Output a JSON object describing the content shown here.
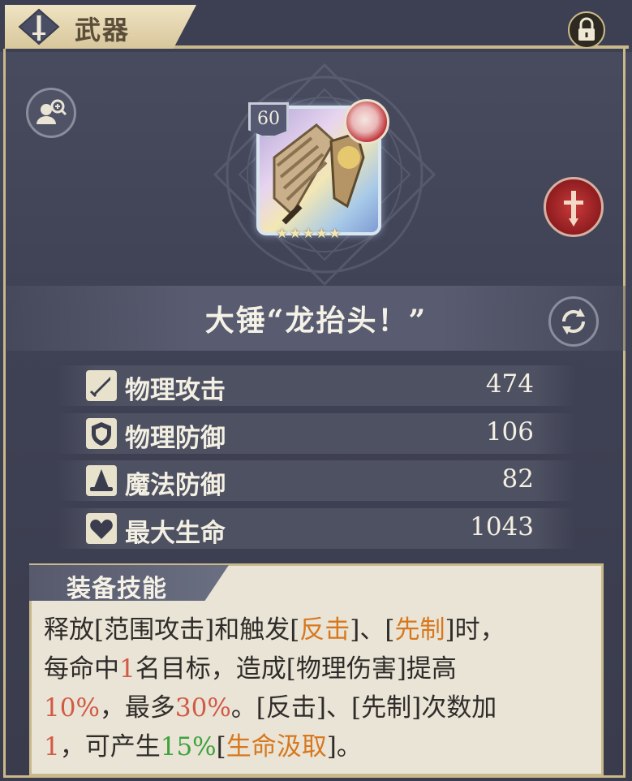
{
  "header": {
    "title": "武器",
    "icons": [
      "weapon-icon",
      "lock-icon"
    ]
  },
  "item": {
    "level": "60",
    "stars": "★★★★★",
    "name": "大锤“龙抬头！”",
    "icons": [
      "search-character-icon",
      "character-portrait",
      "physical-class-icon",
      "refresh-icon"
    ]
  },
  "stats": [
    {
      "label": "物理攻击",
      "value": "474",
      "icon": "sword-icon"
    },
    {
      "label": "物理防御",
      "value": "106",
      "icon": "shield-icon"
    },
    {
      "label": "魔法防御",
      "value": "82",
      "icon": "wizard-hat-icon"
    },
    {
      "label": "最大生命",
      "value": "1043",
      "icon": "heart-icon"
    }
  ],
  "skill": {
    "title": "装备技能",
    "segments": [
      [
        "释放[范围攻击]和触发[",
        ""
      ],
      [
        "反击",
        "orange"
      ],
      [
        "]、[",
        ""
      ],
      [
        "先制",
        "orange"
      ],
      [
        "]时，\n每命中",
        ""
      ],
      [
        "1",
        "red"
      ],
      [
        "名目标，造成[物理伤害]提高\n",
        ""
      ],
      [
        "10%",
        "red"
      ],
      [
        "，最多",
        ""
      ],
      [
        "30%",
        "red"
      ],
      [
        "。[反击]、[先制]次数加\n",
        ""
      ],
      [
        "1",
        "red"
      ],
      [
        "，可产生",
        ""
      ],
      [
        "15%",
        "green"
      ],
      [
        "[",
        ""
      ],
      [
        "生命汲取",
        "orange"
      ],
      [
        "]。",
        ""
      ]
    ]
  },
  "colors": {
    "orange": "#d7781f",
    "red": "#d15a45",
    "green": "#3ea23c",
    "gold": "#c9b98a"
  }
}
